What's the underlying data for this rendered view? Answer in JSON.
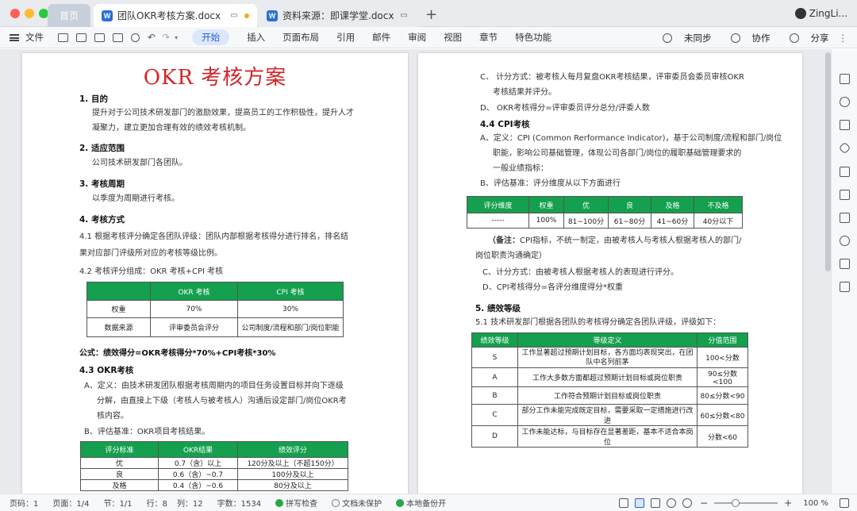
{
  "tabs": {
    "home": "首页",
    "doc1": "团队OKR考核方案.docx",
    "doc2": "资料来源：即课学堂.docx",
    "user": "ZingLi..."
  },
  "menubar": {
    "file": "文件",
    "tabs": [
      "开始",
      "插入",
      "页面布局",
      "引用",
      "邮件",
      "审阅",
      "视图",
      "章节",
      "特色功能"
    ],
    "sync": "未同步",
    "collab": "协作",
    "share": "分享"
  },
  "left_page": {
    "title": "OKR 考核方案",
    "s1_h": "1.  目的",
    "s1_p1": "提升对于公司技术研发部门的激励效果，提高员工的工作积极性，提升人才",
    "s1_p2": "凝聚力，建立更加合理有效的绩效考核机制。",
    "s2_h": "2.  适应范围",
    "s2_p": "公司技术研发部门各团队。",
    "s3_h": "3.  考核周期",
    "s3_p": "以季度为周期进行考核。",
    "s4_h": "4.  考核方式",
    "s41_a": "4.1   根据考核评分确定各团队评级：团队内部根据考核得分进行排名，排名结",
    "s41_b": "果对应部门评级所对应的考核等级比例。",
    "s42": "4.2   考核评分组成：OKR 考核+CPI 考核",
    "t1": {
      "headers": [
        "",
        "OKR 考核",
        "CPI 考核"
      ],
      "rows": [
        [
          "权重",
          "70%",
          "30%"
        ],
        [
          "数据来源",
          "评审委员会评分",
          "公司制度/流程和部门/岗位职能"
        ]
      ]
    },
    "formula": "公式：绩效得分=OKR考核得分*70%+CPI考核*30%",
    "s43_h": "4.3   OKR考核",
    "s43_a1": "A、定义：由技术研发团队根据考核周期内的项目任务设置目标并向下逐级",
    "s43_a2": "分解，由直接上下级（考核人与被考核人）沟通后设定部门/岗位OKR考",
    "s43_a3": "核内容。",
    "s43_b": "B、评估基准：OKR项目考核结果。",
    "t2": {
      "headers": [
        "评分标准",
        "OKR结果",
        "绩效评分"
      ],
      "rows": [
        [
          "优",
          "0.7（含）以上",
          "120分及以上（不超150分）"
        ],
        [
          "良",
          "0.6（含）~0.7",
          "100分及以上"
        ],
        [
          "及格",
          "0.4（含）~0.6",
          "80分及以上"
        ]
      ]
    }
  },
  "right_page": {
    "c1": "C、    计分方式：被考核人每月复盘OKR考核结果，评审委员会委员审核OKR",
    "c2": "考核结果并评分。",
    "d": "D、    OKR考核得分=评审委员评分总分/评委人数",
    "s44_h": "4.4    CPI考核",
    "a1": "A、定义：CPI (Common Rerformance Indicator)，基于公司制度/流程和部门/岗位",
    "a2": "职能，影响公司基础管理，体现公司各部门/岗位的履职基础管理要求的",
    "a3": "一般业绩指标：",
    "b": "B、评估基准：评分维度从以下方面进行",
    "t3": {
      "headers": [
        "评分维度",
        "权重",
        "优",
        "良",
        "及格",
        "不及格"
      ],
      "rows": [
        [
          "-----",
          "100%",
          "81~100分",
          "61~80分",
          "41~60分",
          "40分以下"
        ]
      ]
    },
    "note_label": "（备注：",
    "note1": "CPI指标，不统一制定，由被考核人与考核人根据考核人的部门/",
    "note2": "岗位职责沟通确定）",
    "c": "C、计分方式：由被考核人根据考核人的表现进行评分。",
    "d2": "D、CPI考核得分=各评分维度得分*权重",
    "s5_h": "5.  绩效等级",
    "s51": "5.1  技术研发部门根据各团队的考核得分确定各团队评级，评级如下：",
    "t4": {
      "headers": [
        "绩效等级",
        "等级定义",
        "分值范围"
      ],
      "rows": [
        [
          "S",
          "工作显著超过预期计划目标，各方面均表现突出，在团队中名列前茅",
          "100<分数"
        ],
        [
          "A",
          "工作大多数方面都超过预期计划目标或岗位职责",
          "90≤分数<100"
        ],
        [
          "B",
          "工作符合预期计划目标或岗位职责",
          "80≤分数<90"
        ],
        [
          "C",
          "部分工作未能完成既定目标，需要采取一定措施进行改进",
          "60≤分数<80"
        ],
        [
          "D",
          "工作未能达标，与目标存在显著差距，基本不适合本岗位",
          "分数<60"
        ]
      ]
    }
  },
  "status": {
    "page_num": "页码：1",
    "pages": "页面：1/4",
    "section": "节：1/1",
    "row": "行：8",
    "col": "列：12",
    "words": "字数：1534",
    "spell": "拼写检查",
    "protect": "文档未保护",
    "backup": "本地备份开",
    "zoom": "100 %"
  },
  "colors": {
    "accent": "#1f5ee0",
    "table_header": "#14a04e",
    "title_red": "#d0252a"
  }
}
